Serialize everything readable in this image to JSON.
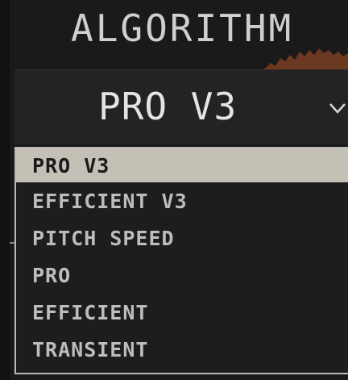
{
  "header": {
    "title": "ALGORITHM"
  },
  "select": {
    "value": "PRO V3"
  },
  "dropdown": {
    "options": [
      {
        "label": "PRO V3",
        "selected": true
      },
      {
        "label": "EFFICIENT V3",
        "selected": false
      },
      {
        "label": "PITCH SPEED",
        "selected": false
      },
      {
        "label": "PRO",
        "selected": false
      },
      {
        "label": "EFFICIENT",
        "selected": false
      },
      {
        "label": "TRANSIENT",
        "selected": false
      }
    ]
  },
  "colors": {
    "background": "#1a1a1a",
    "selected_bg": "#c4c0b6",
    "text": "#bdbdbd",
    "accent_waveform": "#8a4a2a"
  }
}
